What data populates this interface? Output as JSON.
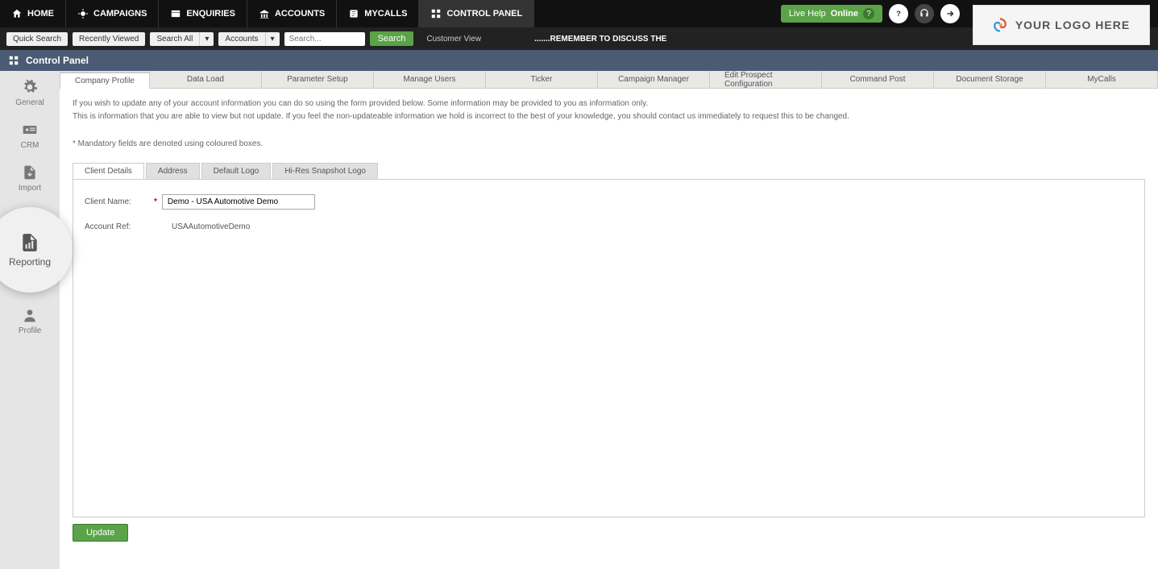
{
  "topnav": {
    "items": [
      {
        "label": "HOME",
        "icon": "home"
      },
      {
        "label": "CAMPAIGNS",
        "icon": "campaign"
      },
      {
        "label": "ENQUIRIES",
        "icon": "enquiries"
      },
      {
        "label": "ACCOUNTS",
        "icon": "accounts"
      },
      {
        "label": "MYCALLS",
        "icon": "mycalls"
      },
      {
        "label": "CONTROL PANEL",
        "icon": "control"
      }
    ],
    "live_help": "Live Help",
    "live_help_status": "Online"
  },
  "secondbar": {
    "quick_search": "Quick Search",
    "recently_viewed": "Recently Viewed",
    "dd1": "Search All",
    "dd2": "Accounts",
    "search_placeholder": "Search...",
    "search_btn": "Search",
    "customer_view": "Customer View",
    "ticker": ".......REMEMBER TO DISCUSS THE"
  },
  "breadcrumb": {
    "title": "Control Panel"
  },
  "sidebar": {
    "items": [
      {
        "label": "General"
      },
      {
        "label": "CRM"
      },
      {
        "label": "Import"
      },
      {
        "label": "Reporting"
      },
      {
        "label": "Profile"
      }
    ]
  },
  "tabs": [
    "Company Profile",
    "Data Load",
    "Parameter Setup",
    "Manage Users",
    "Ticker",
    "Campaign Manager",
    "Edit Prospect Configuration",
    "Command Post",
    "Document Storage",
    "MyCalls"
  ],
  "content": {
    "p1": "If you wish to update any of your account information you can do so using the form provided below. Some information may be provided to you as information only.",
    "p2": "This is information that you are able to view but not update. If you feel the non-updateable information we hold is incorrect to the best of your knowledge, you should contact us immediately to request this to be changed.",
    "note": "* Mandatory fields are denoted using coloured boxes."
  },
  "subtabs": [
    "Client Details",
    "Address",
    "Default Logo",
    "Hi-Res Snapshot Logo"
  ],
  "form": {
    "client_name_label": "Client Name:",
    "client_name_value": "Demo - USA Automotive Demo",
    "account_ref_label": "Account Ref:",
    "account_ref_value": "USAAutomotiveDemo",
    "update_btn": "Update"
  },
  "logo_text": "YOUR LOGO HERE"
}
